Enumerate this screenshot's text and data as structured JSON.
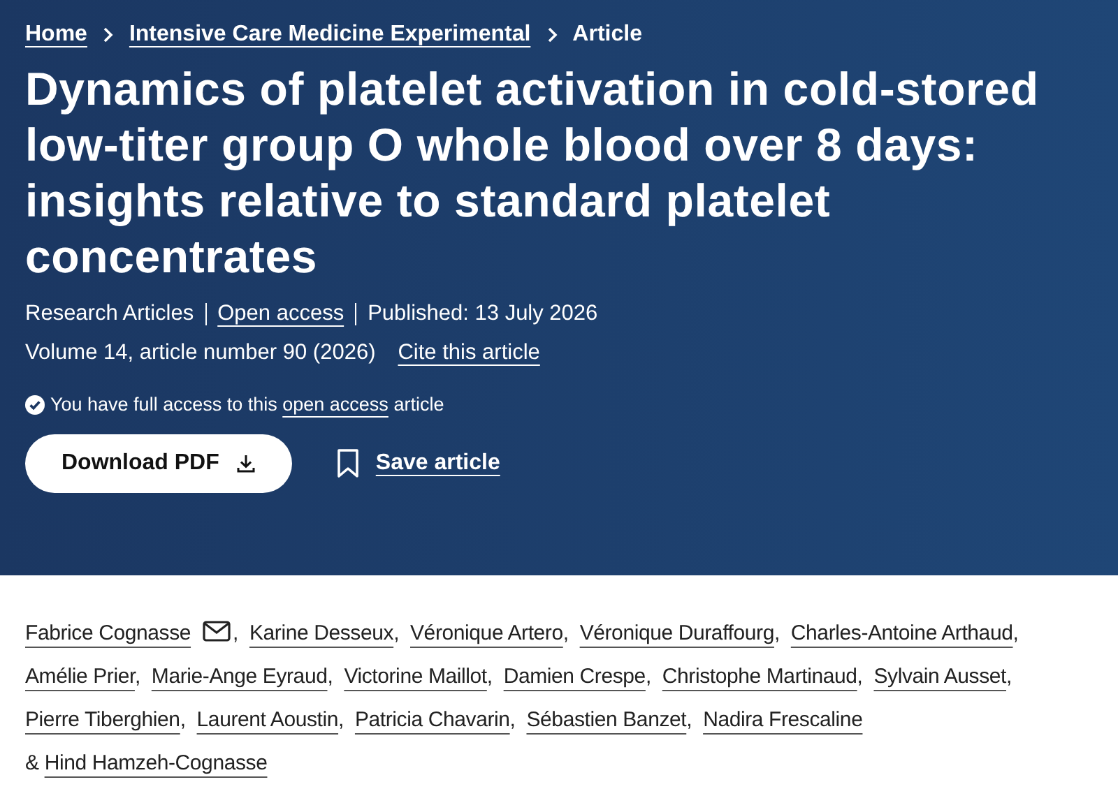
{
  "breadcrumbs": [
    {
      "label": "Home",
      "kind": "link"
    },
    {
      "label": "Intensive Care Medicine Experimental",
      "kind": "link"
    },
    {
      "label": "Article",
      "kind": "current"
    }
  ],
  "title": "Dynamics of platelet activation in cold-stored low-titer group O whole blood over 8 days: insights relative to standard platelet concentrates",
  "meta": [
    {
      "text": "Research Articles",
      "kind": "text"
    },
    {
      "text": "Open access",
      "kind": "link"
    },
    {
      "text": "Published: 13 July 2026",
      "kind": "text"
    }
  ],
  "citation": {
    "volume": "Volume 14, article number 90 (2026)",
    "cite_link": "Cite this article"
  },
  "access_notice": {
    "before": "You have full access to this",
    "link": "open access",
    "after": "article"
  },
  "actions": {
    "download": "Download PDF",
    "save": "Save article"
  },
  "authors": [
    {
      "name": "Fabrice Cognasse",
      "corresponding": true,
      "joiner": ","
    },
    {
      "name": "Karine Desseux",
      "corresponding": false,
      "joiner": ","
    },
    {
      "name": "Véronique Artero",
      "corresponding": false,
      "joiner": ","
    },
    {
      "name": "Véronique Duraffourg",
      "corresponding": false,
      "joiner": ","
    },
    {
      "name": "Charles-Antoine Arthaud",
      "corresponding": false,
      "joiner": ","
    },
    {
      "name": "Amélie Prier",
      "corresponding": false,
      "joiner": ","
    },
    {
      "name": "Marie-Ange Eyraud",
      "corresponding": false,
      "joiner": ","
    },
    {
      "name": "Victorine Maillot",
      "corresponding": false,
      "joiner": ","
    },
    {
      "name": "Damien Crespe",
      "corresponding": false,
      "joiner": ","
    },
    {
      "name": "Christophe Martinaud",
      "corresponding": false,
      "joiner": ","
    },
    {
      "name": "Sylvain Ausset",
      "corresponding": false,
      "joiner": ","
    },
    {
      "name": "Pierre Tiberghien",
      "corresponding": false,
      "joiner": ","
    },
    {
      "name": "Laurent Aoustin",
      "corresponding": false,
      "joiner": ","
    },
    {
      "name": "Patricia Chavarin",
      "corresponding": false,
      "joiner": ","
    },
    {
      "name": "Sébastien Banzet",
      "corresponding": false,
      "joiner": ","
    },
    {
      "name": "Nadira Frescaline",
      "corresponding": false,
      "joiner": "&"
    },
    {
      "name": "Hind Hamzeh-Cognasse",
      "corresponding": false
    }
  ]
}
